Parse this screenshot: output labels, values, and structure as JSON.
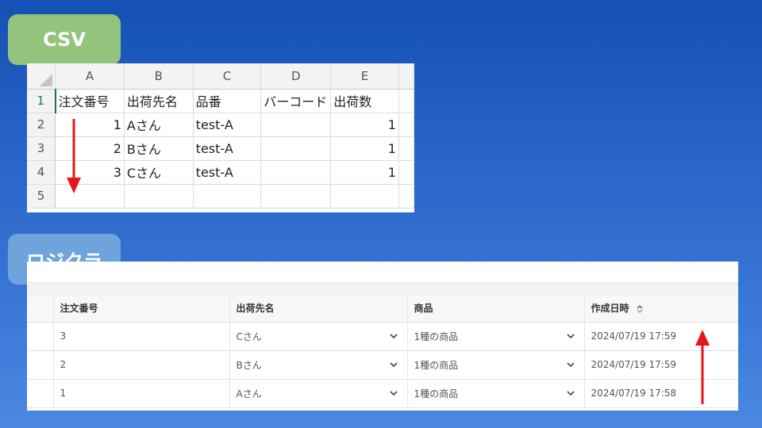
{
  "labels": {
    "csv": "CSV",
    "logi": "ロジクラ"
  },
  "sheet": {
    "columns": [
      "A",
      "B",
      "C",
      "D",
      "E"
    ],
    "rows": [
      {
        "num": "1",
        "cells": [
          "注文番号",
          "出荷先名",
          "品番",
          "バーコード",
          "出荷数"
        ]
      },
      {
        "num": "2",
        "cells": [
          "1",
          "Aさん",
          "test-A",
          "",
          "1"
        ]
      },
      {
        "num": "3",
        "cells": [
          "2",
          "Bさん",
          "test-A",
          "",
          "1"
        ]
      },
      {
        "num": "4",
        "cells": [
          "3",
          "Cさん",
          "test-A",
          "",
          "1"
        ]
      },
      {
        "num": "5",
        "cells": [
          "",
          "",
          "",
          "",
          ""
        ]
      }
    ]
  },
  "logi": {
    "headers": [
      "注文番号",
      "出荷先名",
      "商品",
      "作成日時"
    ],
    "rows": [
      {
        "order": "3",
        "dest": "Cさん",
        "product": "1種の商品",
        "date": "2024/07/19 17:59"
      },
      {
        "order": "2",
        "dest": "Bさん",
        "product": "1種の商品",
        "date": "2024/07/19 17:59"
      },
      {
        "order": "1",
        "dest": "Aさん",
        "product": "1種の商品",
        "date": "2024/07/19 17:58"
      }
    ]
  },
  "colors": {
    "arrow": "#e8141c",
    "csv_badge": "#93c47d",
    "logi_badge": "#6fa3dc"
  },
  "icons": [
    "chevron-down-icon",
    "sort-icon",
    "arrow-down",
    "arrow-up"
  ]
}
